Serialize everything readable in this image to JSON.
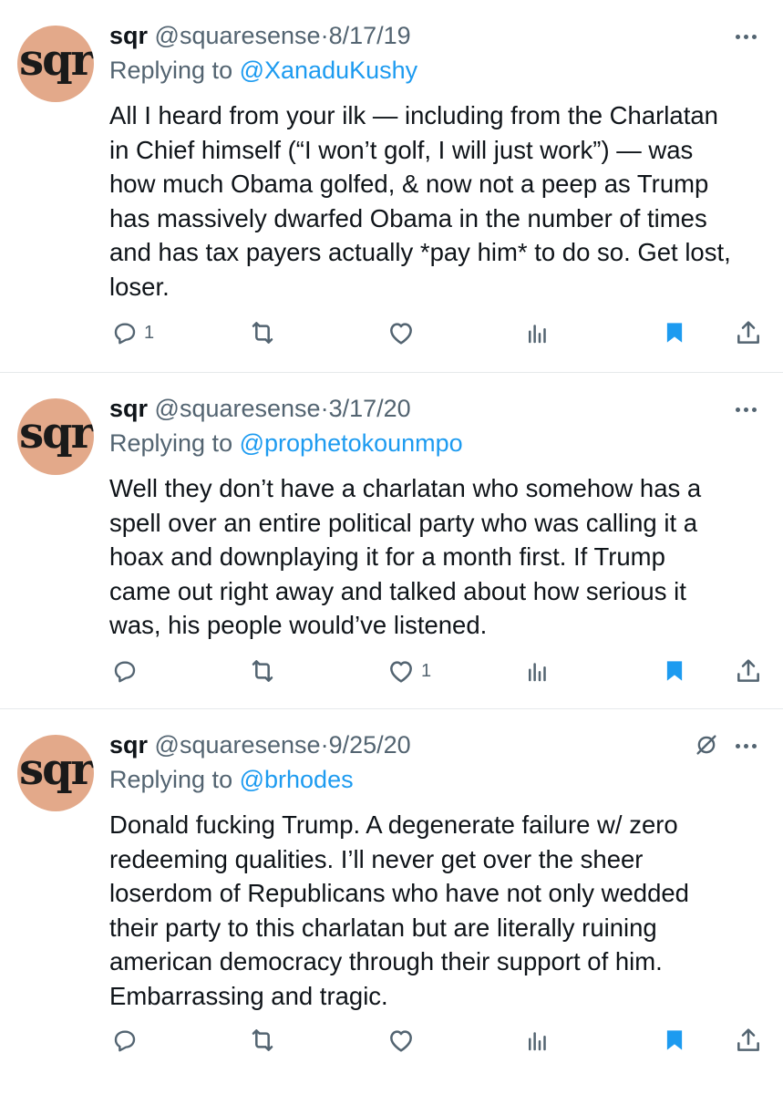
{
  "tweets": [
    {
      "avatar_text": "sqr",
      "name": "sqr",
      "handle": "@squaresense",
      "separator": "·",
      "date": "8/17/19",
      "replying_prefix": "Replying to",
      "replying_to": "@XanaduKushy",
      "text": "All I heard from your ilk — including from the Charlatan\nin Chief himself (“I won’t golf, I will just work”) — was\nhow much Obama golfed, & now not a peep as Trump\nhas massively dwarfed Obama in the number of times\nand has tax payers actually *pay him* to do so. Get lost,\nloser.",
      "reply_count": "1",
      "like_count": ""
    },
    {
      "avatar_text": "sqr",
      "name": "sqr",
      "handle": "@squaresense",
      "separator": "·",
      "date": "3/17/20",
      "replying_prefix": "Replying to",
      "replying_to": "@prophetokounmpo",
      "text": "Well they don’t have a charlatan who somehow has a\nspell over an entire political party who was calling it a\nhoax and downplaying it for a month first. If Trump\ncame out right away and talked about how serious it\nwas, his people would’ve listened.",
      "reply_count": "",
      "like_count": "1"
    },
    {
      "avatar_text": "sqr",
      "name": "sqr",
      "handle": "@squaresense",
      "separator": "·",
      "date": "9/25/20",
      "replying_prefix": "Replying to",
      "replying_to": "@brhodes",
      "text": "Donald fucking Trump. A degenerate failure w/ zero\nredeeming qualities. I’ll never get over the sheer\nloserdom of Republicans who have not only wedded\ntheir party to this charlatan but are literally ruining\namerican democracy through their support of him.\nEmbarrassing and tragic.",
      "reply_count": "",
      "like_count": ""
    }
  ],
  "colors": {
    "text": "#0f1419",
    "secondary": "#536471",
    "link": "#1d9bf0",
    "bookmark": "#1d9bf0",
    "avatar_bg": "#e3a98a",
    "divider": "#e6e9eb"
  },
  "icons": [
    "reply-icon",
    "retweet-icon",
    "like-icon",
    "views-icon",
    "bookmark-icon",
    "share-icon",
    "more-icon",
    "muted-conversation-icon"
  ]
}
